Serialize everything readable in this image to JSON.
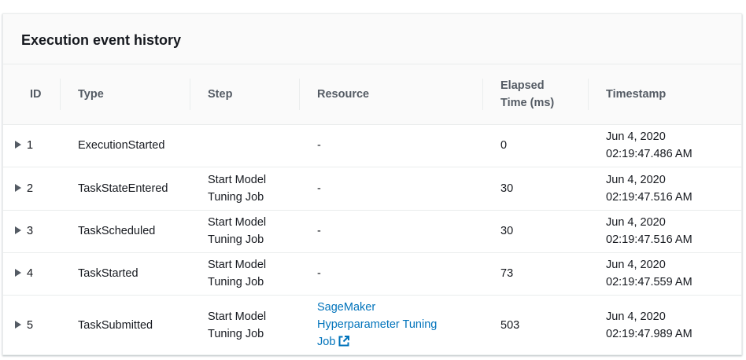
{
  "panel": {
    "title": "Execution event history"
  },
  "columns": {
    "id": "ID",
    "type": "Type",
    "step": "Step",
    "resource": "Resource",
    "elapsed_line1": "Elapsed",
    "elapsed_line2": "Time (ms)",
    "timestamp": "Timestamp"
  },
  "rows": [
    {
      "id": "1",
      "type": "ExecutionStarted",
      "step_line1": "",
      "step_line2": "",
      "resource": "-",
      "elapsed": "0",
      "date": "Jun 4, 2020",
      "time": "02:19:47.486 AM"
    },
    {
      "id": "2",
      "type": "TaskStateEntered",
      "step_line1": "Start Model",
      "step_line2": "Tuning Job",
      "resource": "-",
      "elapsed": "30",
      "date": "Jun 4, 2020",
      "time": "02:19:47.516 AM"
    },
    {
      "id": "3",
      "type": "TaskScheduled",
      "step_line1": "Start Model",
      "step_line2": "Tuning Job",
      "resource": "-",
      "elapsed": "30",
      "date": "Jun 4, 2020",
      "time": "02:19:47.516 AM"
    },
    {
      "id": "4",
      "type": "TaskStarted",
      "step_line1": "Start Model",
      "step_line2": "Tuning Job",
      "resource": "-",
      "elapsed": "73",
      "date": "Jun 4, 2020",
      "time": "02:19:47.559 AM"
    },
    {
      "id": "5",
      "type": "TaskSubmitted",
      "step_line1": "Start Model",
      "step_line2": "Tuning Job",
      "resource_link_line1": "SageMaker",
      "resource_link_line2": "Hyperparameter Tuning",
      "resource_link_line3": "Job",
      "elapsed": "503",
      "date": "Jun 4, 2020",
      "time": "02:19:47.989 AM"
    }
  ],
  "icons": {
    "expand": "caret-right-icon",
    "external": "external-link-icon"
  },
  "colors": {
    "link": "#0073bb",
    "header_text": "#545b64",
    "text": "#16191f"
  }
}
